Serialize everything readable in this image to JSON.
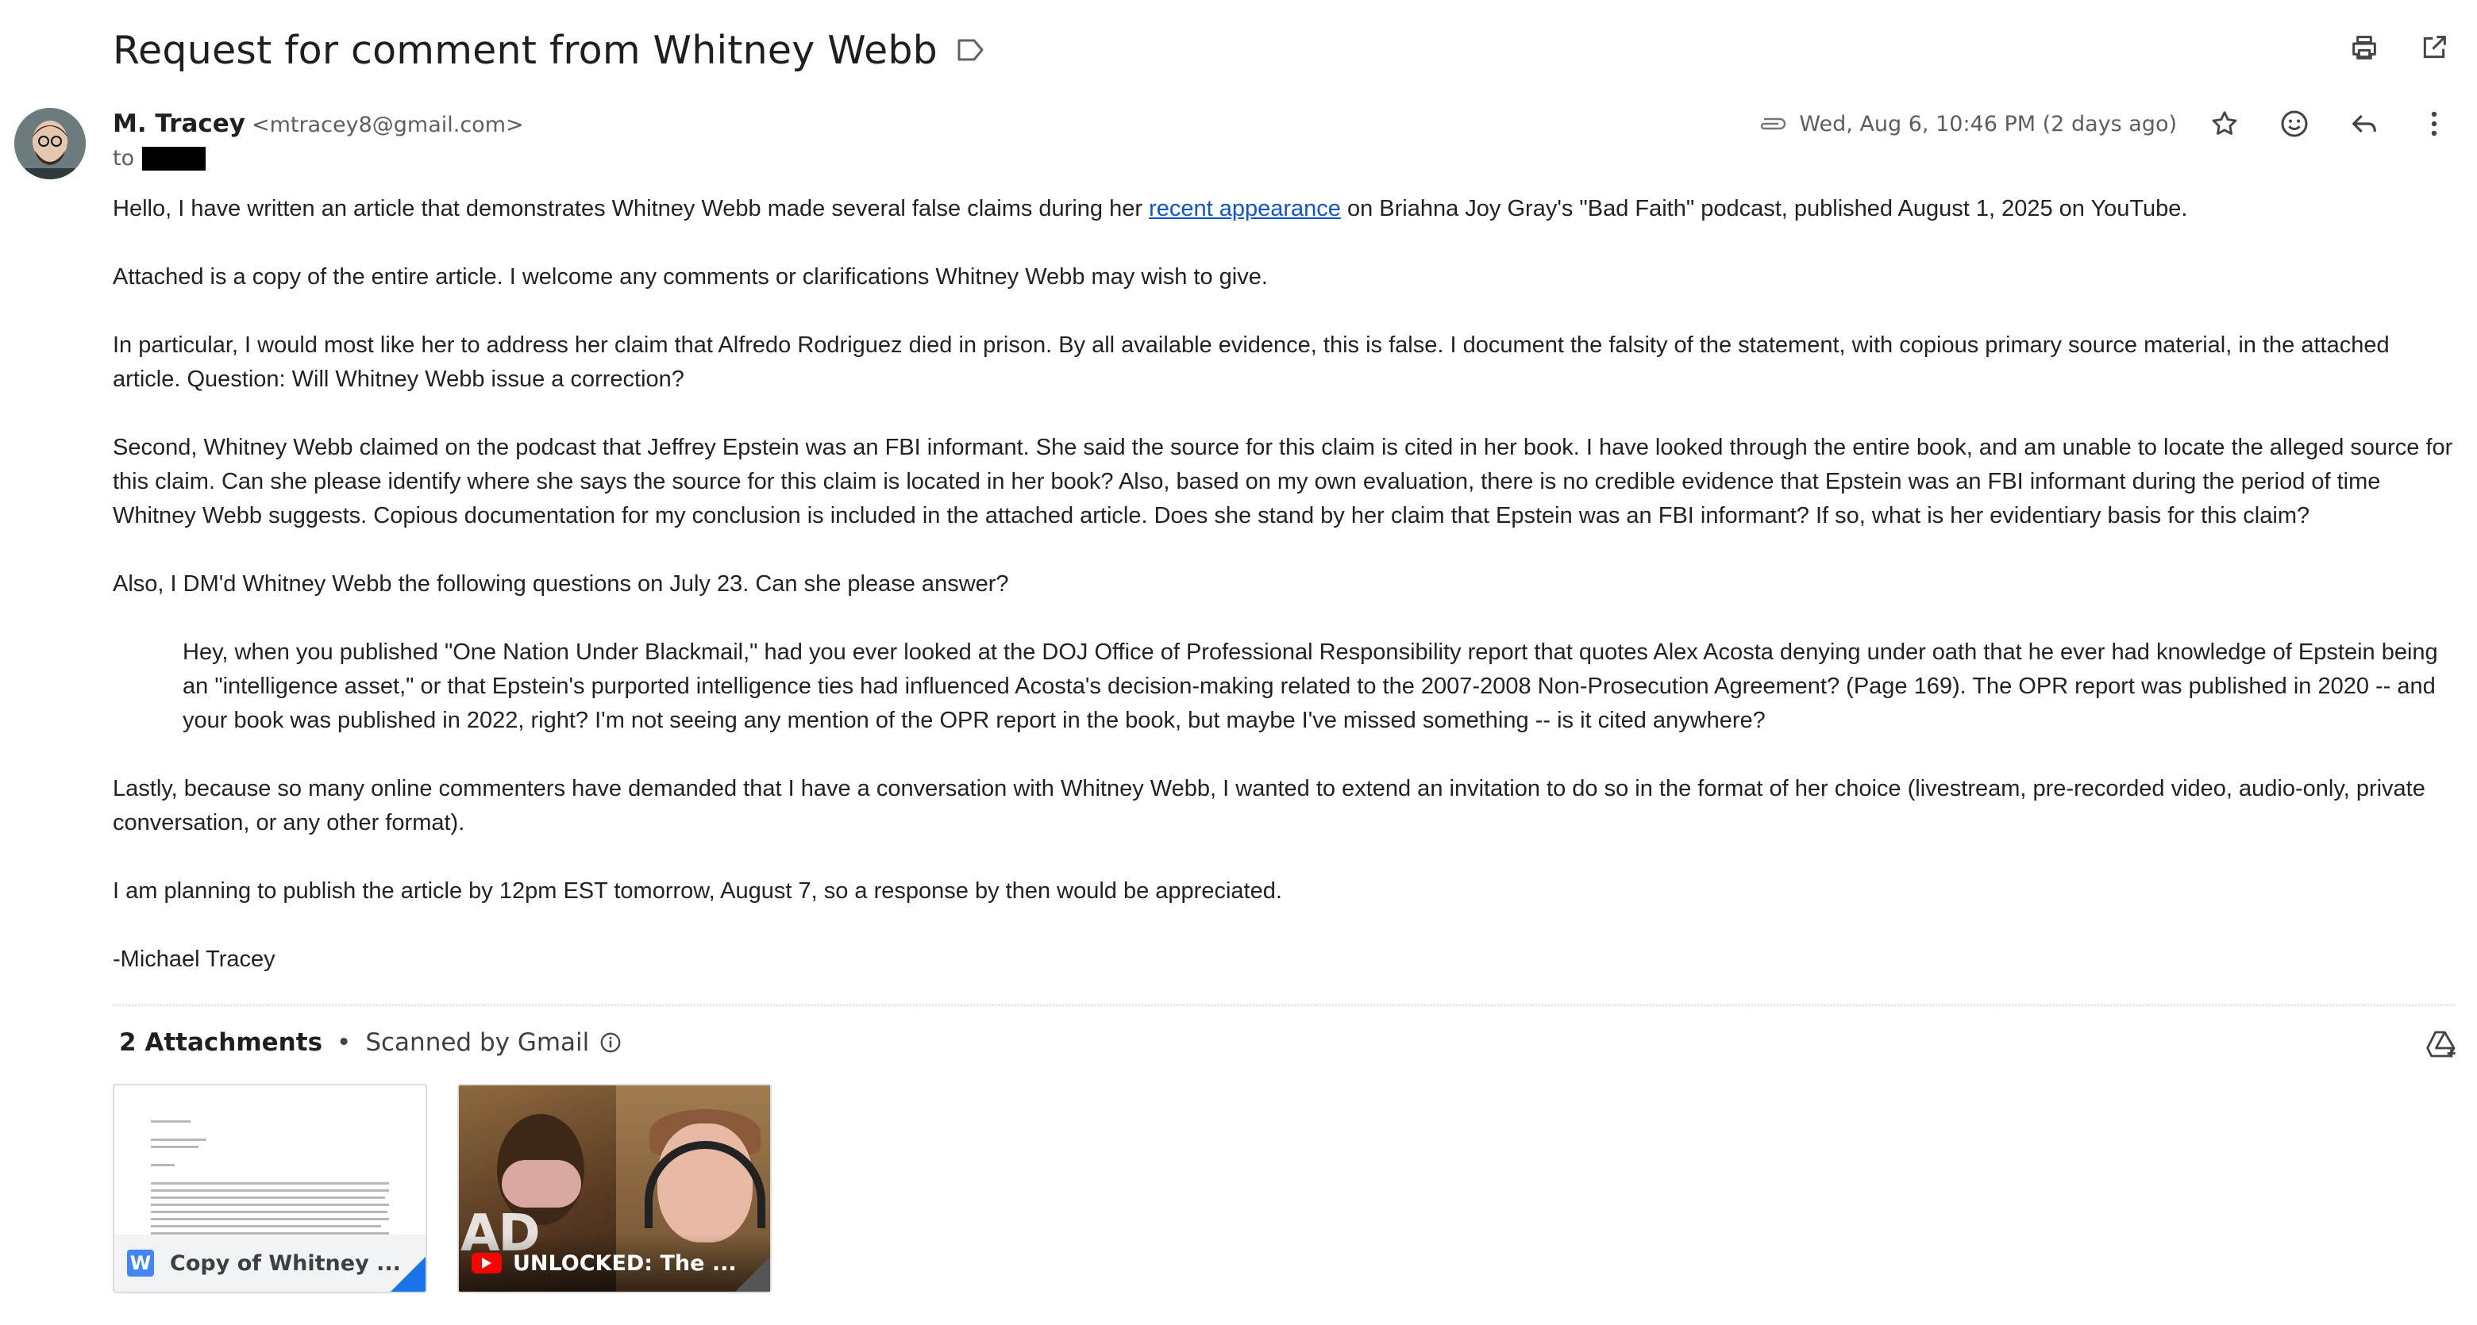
{
  "email": {
    "subject": "Request for comment from Whitney Webb",
    "sender_name": "M. Tracey",
    "sender_email": "<mtracey8@gmail.com>",
    "to_label": "to",
    "date": "Wed, Aug 6, 10:46 PM (2 days ago)"
  },
  "body": {
    "p1_before_link": "Hello, I have written an article that demonstrates Whitney Webb made several false claims during her ",
    "p1_link": "recent appearance",
    "p1_after_link": " on Briahna Joy Gray's \"Bad Faith\" podcast, published August 1, 2025 on YouTube.",
    "p2": "Attached is a copy of the entire article. I welcome any comments or clarifications Whitney Webb may wish to give.",
    "p3": "In particular, I would most like her to address her claim that Alfredo Rodriguez died in prison. By all available evidence, this is false. I document the falsity of the statement, with copious primary source material, in the attached article. Question: Will Whitney Webb issue a correction?",
    "p4": "Second, Whitney Webb claimed on the podcast that Jeffrey Epstein was an FBI informant. She said the source for this claim is cited in her book. I have looked through the entire book, and am unable to locate the alleged source for this claim. Can she please identify where she says the source for this claim is located in her book? Also, based on my own evaluation, there is no credible evidence that Epstein was an FBI informant during the period of time Whitney Webb suggests. Copious documentation for my conclusion is included in the attached article. Does she stand by her claim that Epstein was an FBI informant? If so, what is her evidentiary basis for this claim?",
    "p5": "Also, I DM'd Whitney Webb the following questions on July 23. Can she please answer?",
    "quote": "Hey, when you published \"One Nation Under Blackmail,\" had you ever looked at the DOJ Office of Professional Responsibility report that quotes Alex Acosta denying under oath that he ever had knowledge of Epstein being an \"intelligence asset,\" or that Epstein's purported intelligence ties had influenced Acosta's decision-making related to the 2007-2008 Non-Prosecution Agreement? (Page 169). The OPR report was published in 2020 -- and your book was published in 2022, right? I'm not seeing any mention of the OPR report in the book, but maybe I've missed something -- is it cited anywhere?",
    "p6": "Lastly, because so many online commenters have demanded that I have a conversation with Whitney Webb, I wanted to extend an invitation to do so in the format of her choice (livestream, pre-recorded video, audio-only, private conversation, or any other format).",
    "p7": "I am planning to publish the article by 12pm EST tomorrow, August 7, so a response by then would be appreciated.",
    "signature": "-Michael Tracey"
  },
  "attachments": {
    "count_label": "2 Attachments",
    "separator": "•",
    "scanned_label": "Scanned by Gmail",
    "items": [
      {
        "name": "Copy of Whitney ...",
        "type_badge": "W",
        "icon": "word-doc-icon"
      },
      {
        "name": "UNLOCKED: The ...",
        "thumbnail_text": "AD",
        "icon": "youtube-icon"
      }
    ]
  },
  "icons": {
    "label": "label-icon",
    "print": "print-icon",
    "open_new_window": "open-in-new-window-icon",
    "attachment": "paperclip-icon",
    "star": "star-icon",
    "emoji": "emoji-reaction-icon",
    "reply": "reply-icon",
    "more": "more-vert-icon",
    "info": "info-icon",
    "add_to_drive": "add-to-drive-icon"
  },
  "colors": {
    "link": "#1155cc",
    "text": "#222222",
    "secondary_text": "#5e5e5e",
    "word_blue": "#4285f4",
    "youtube_red": "#ff0000"
  }
}
